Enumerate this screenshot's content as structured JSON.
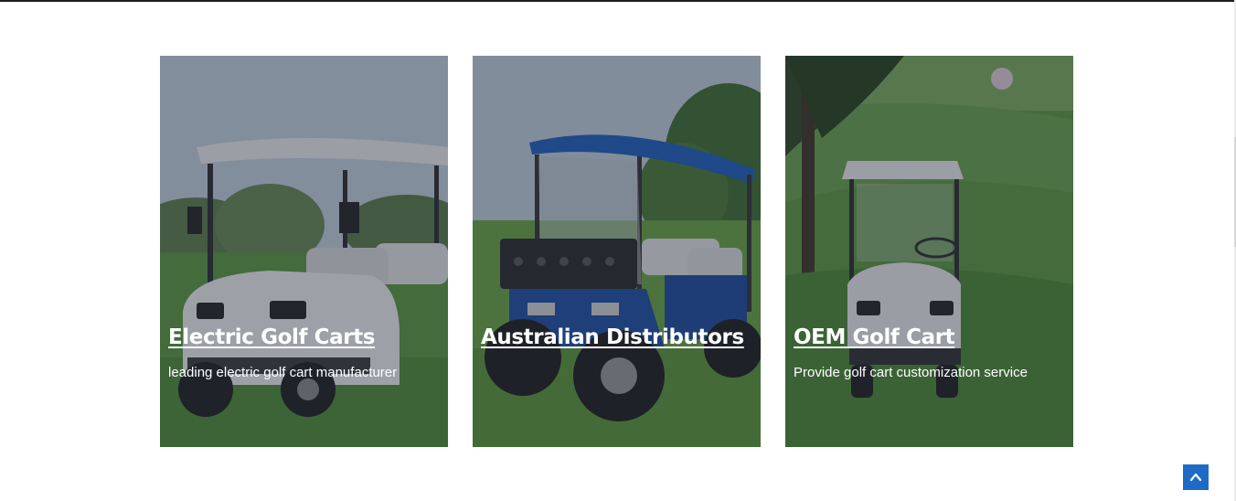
{
  "cards": [
    {
      "title": "Electric Golf Carts",
      "description": "leading electric golf cart manufacturer"
    },
    {
      "title": "Australian Distributors",
      "description": ""
    },
    {
      "title": "OEM Golf Cart",
      "description": "Provide golf cart customization service"
    }
  ],
  "back_to_top": {
    "icon": "chevron-up-icon",
    "color": "#1e6bc7"
  }
}
